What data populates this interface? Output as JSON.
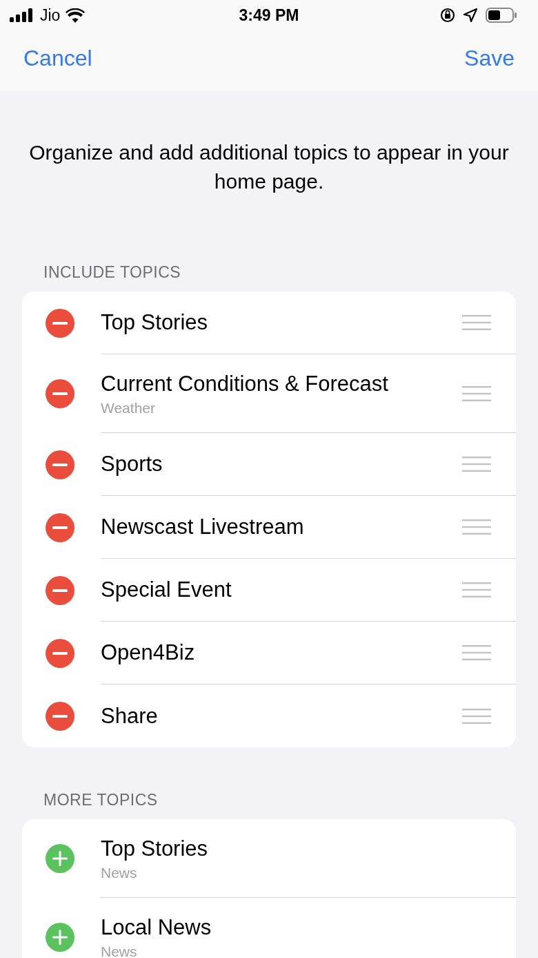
{
  "status_bar": {
    "carrier": "Jio",
    "time": "3:49 PM"
  },
  "nav": {
    "cancel": "Cancel",
    "save": "Save"
  },
  "description": "Organize and add additional topics to appear in your home page.",
  "sections": [
    {
      "header": "INCLUDE TOPICS",
      "items": [
        {
          "kind": "remove",
          "title": "Top Stories"
        },
        {
          "kind": "remove",
          "title": "Current Conditions & Forecast",
          "subtitle": "Weather"
        },
        {
          "kind": "remove",
          "title": "Sports"
        },
        {
          "kind": "remove",
          "title": "Newscast Livestream"
        },
        {
          "kind": "remove",
          "title": "Special Event"
        },
        {
          "kind": "remove",
          "title": "Open4Biz"
        },
        {
          "kind": "remove",
          "title": "Share"
        }
      ]
    },
    {
      "header": "MORE TOPICS",
      "items": [
        {
          "kind": "add",
          "title": "Top Stories",
          "subtitle": "News"
        },
        {
          "kind": "add",
          "title": "Local News",
          "subtitle": "News"
        }
      ]
    }
  ]
}
